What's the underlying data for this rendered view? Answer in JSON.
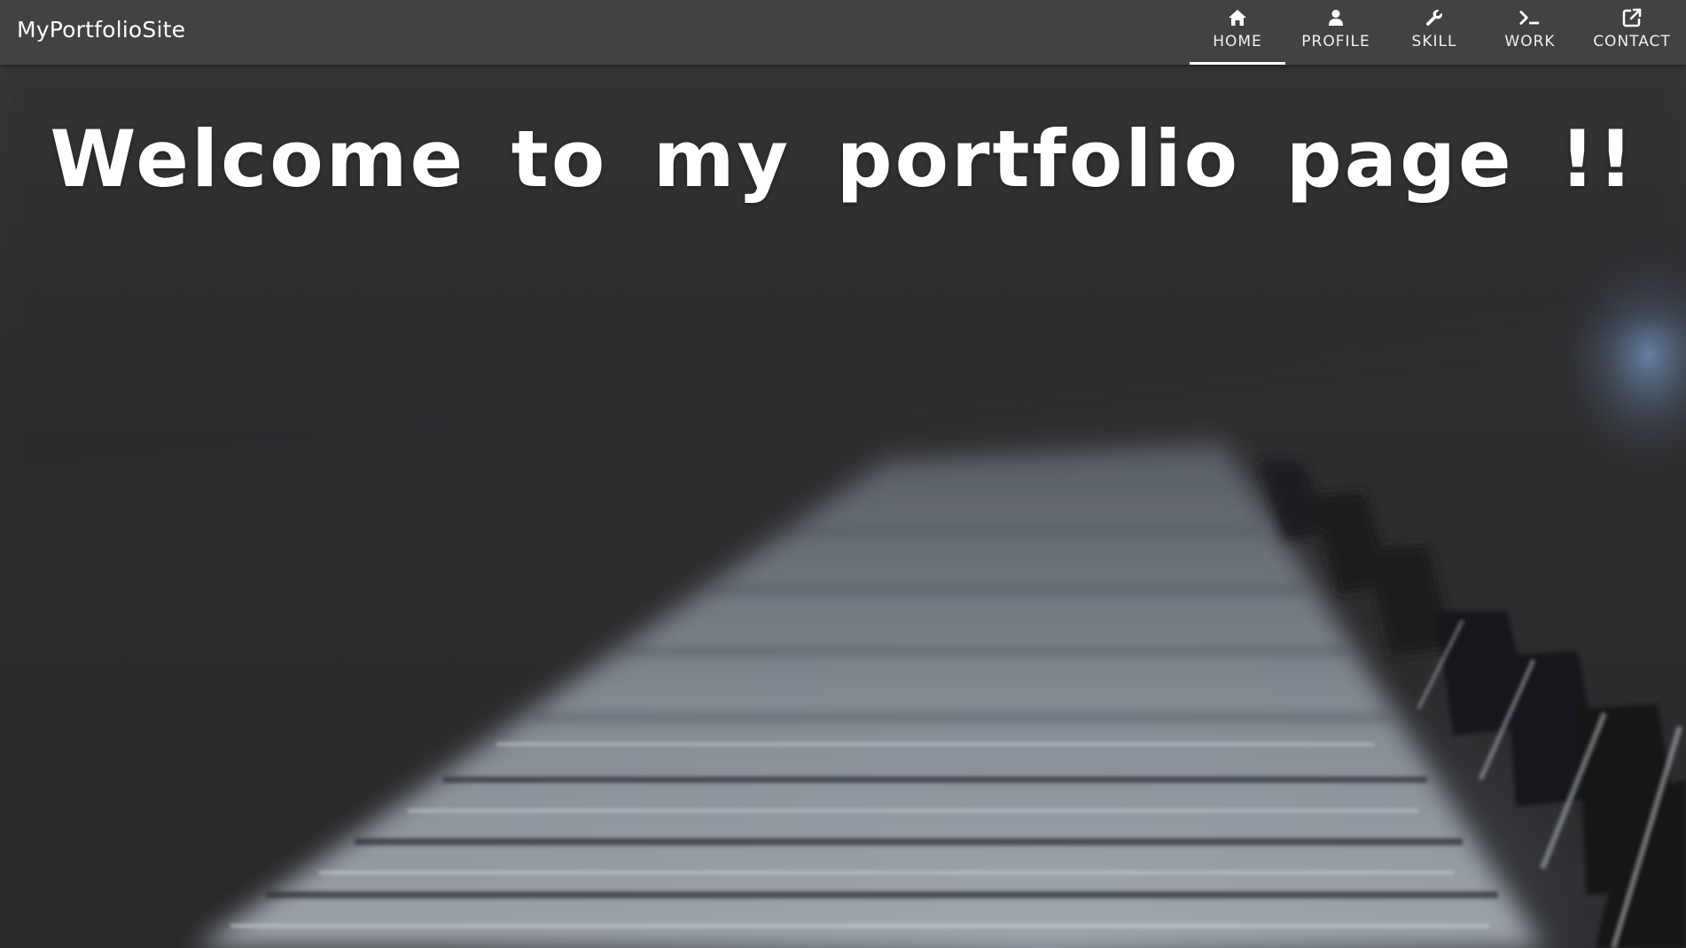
{
  "navbar": {
    "brand": "MyPortfolioSite",
    "items": [
      {
        "label": "HOME",
        "icon": "home-icon",
        "active": true
      },
      {
        "label": "PROFILE",
        "icon": "user-icon",
        "active": false
      },
      {
        "label": "SKILL",
        "icon": "wrench-icon",
        "active": false
      },
      {
        "label": "WORK",
        "icon": "terminal-icon",
        "active": false
      },
      {
        "label": "CONTACT",
        "icon": "external-link-icon",
        "active": false
      }
    ]
  },
  "hero": {
    "headline": "Welcome to my portfolio page !!",
    "background": "piano-keys-photo"
  },
  "colors": {
    "navbar_bg": "#424242",
    "text": "#ffffff",
    "active_indicator": "#ffffff"
  }
}
